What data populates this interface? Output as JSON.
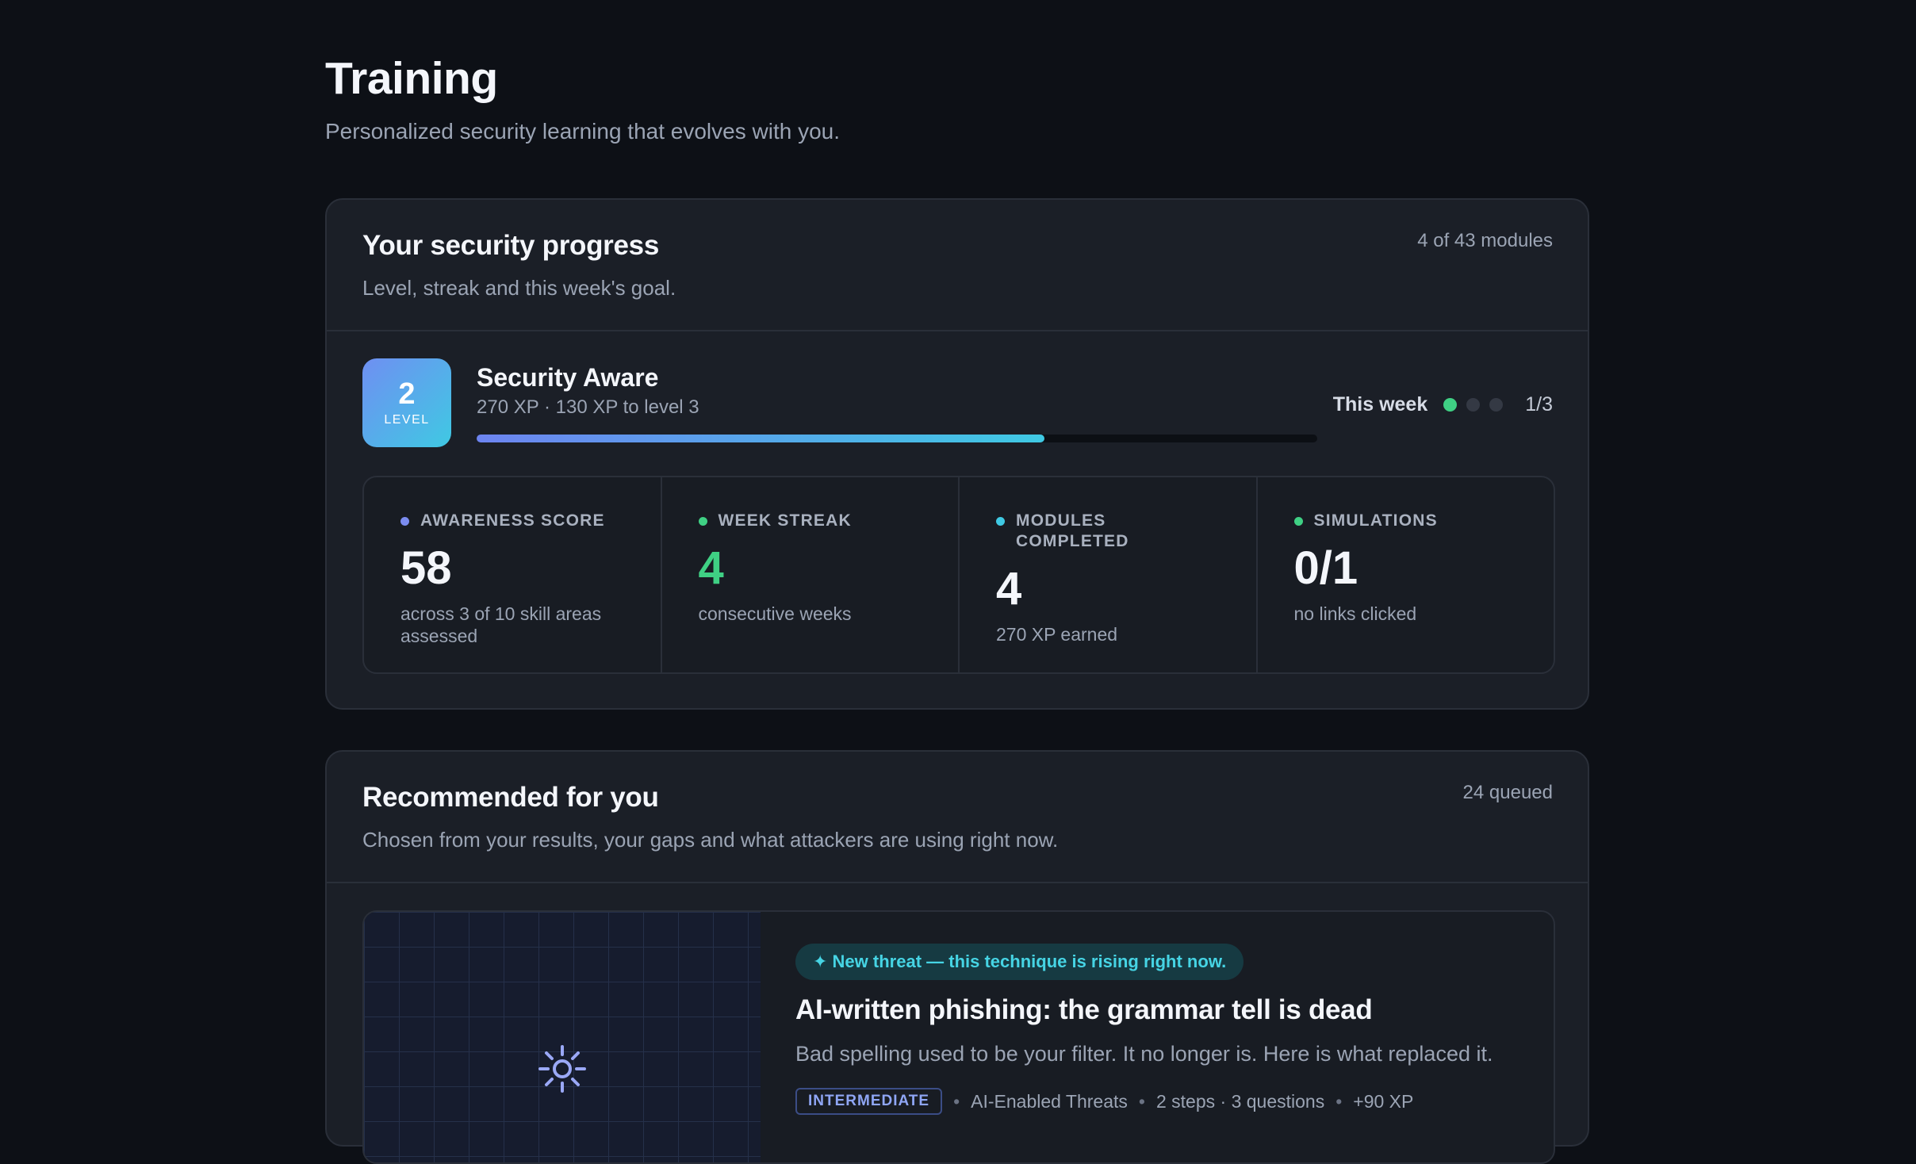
{
  "header": {
    "title": "Training",
    "subtitle": "Personalized security learning that evolves with you."
  },
  "progress": {
    "title": "Your security progress",
    "subtitle": "Level, streak and this week's goal.",
    "modules_meta": "4 of 43 modules",
    "level": {
      "number": "2",
      "label": "LEVEL",
      "name": "Security Aware",
      "xp_text": "270 XP · 130 XP to level 3",
      "xp_progress_fraction": 0.675
    },
    "week": {
      "label": "This week",
      "done": 1,
      "goal": 3,
      "count_text": "1/3"
    },
    "stats": [
      {
        "label": "AWARENESS SCORE",
        "value": "58",
        "note": "across 3 of 10 skill areas assessed",
        "dot_color": "#7b8cf0",
        "value_green": false
      },
      {
        "label": "WEEK STREAK",
        "value": "4",
        "note": "consecutive weeks",
        "dot_color": "#3fd084",
        "value_green": true
      },
      {
        "label": "MODULES COMPLETED",
        "value": "4",
        "note": "270 XP earned",
        "dot_color": "#3fc9e3",
        "value_green": false
      },
      {
        "label": "SIMULATIONS",
        "value": "0/1",
        "note": "no links clicked",
        "dot_color": "#3fd084",
        "value_green": false
      }
    ]
  },
  "recommended": {
    "title": "Recommended for you",
    "subtitle": "Chosen from your results, your gaps and what attackers are using right now.",
    "queued_meta": "24 queued",
    "item": {
      "icon": "sun-icon",
      "threat_pill": "✦ New threat — this technique is rising right now.",
      "title": "AI-written phishing: the grammar tell is dead",
      "description": "Bad spelling used to be your filter. It no longer is. Here is what replaced it.",
      "difficulty": "INTERMEDIATE",
      "category": "AI-Enabled Threats",
      "steps": "2 steps · 3 questions",
      "xp": "+90 XP"
    }
  },
  "colors": {
    "background": "#0d1016",
    "card": "#1b1f27",
    "accent_green": "#3fd084",
    "accent_cyan": "#3fc9e3",
    "accent_indigo": "#6f8ff2"
  }
}
